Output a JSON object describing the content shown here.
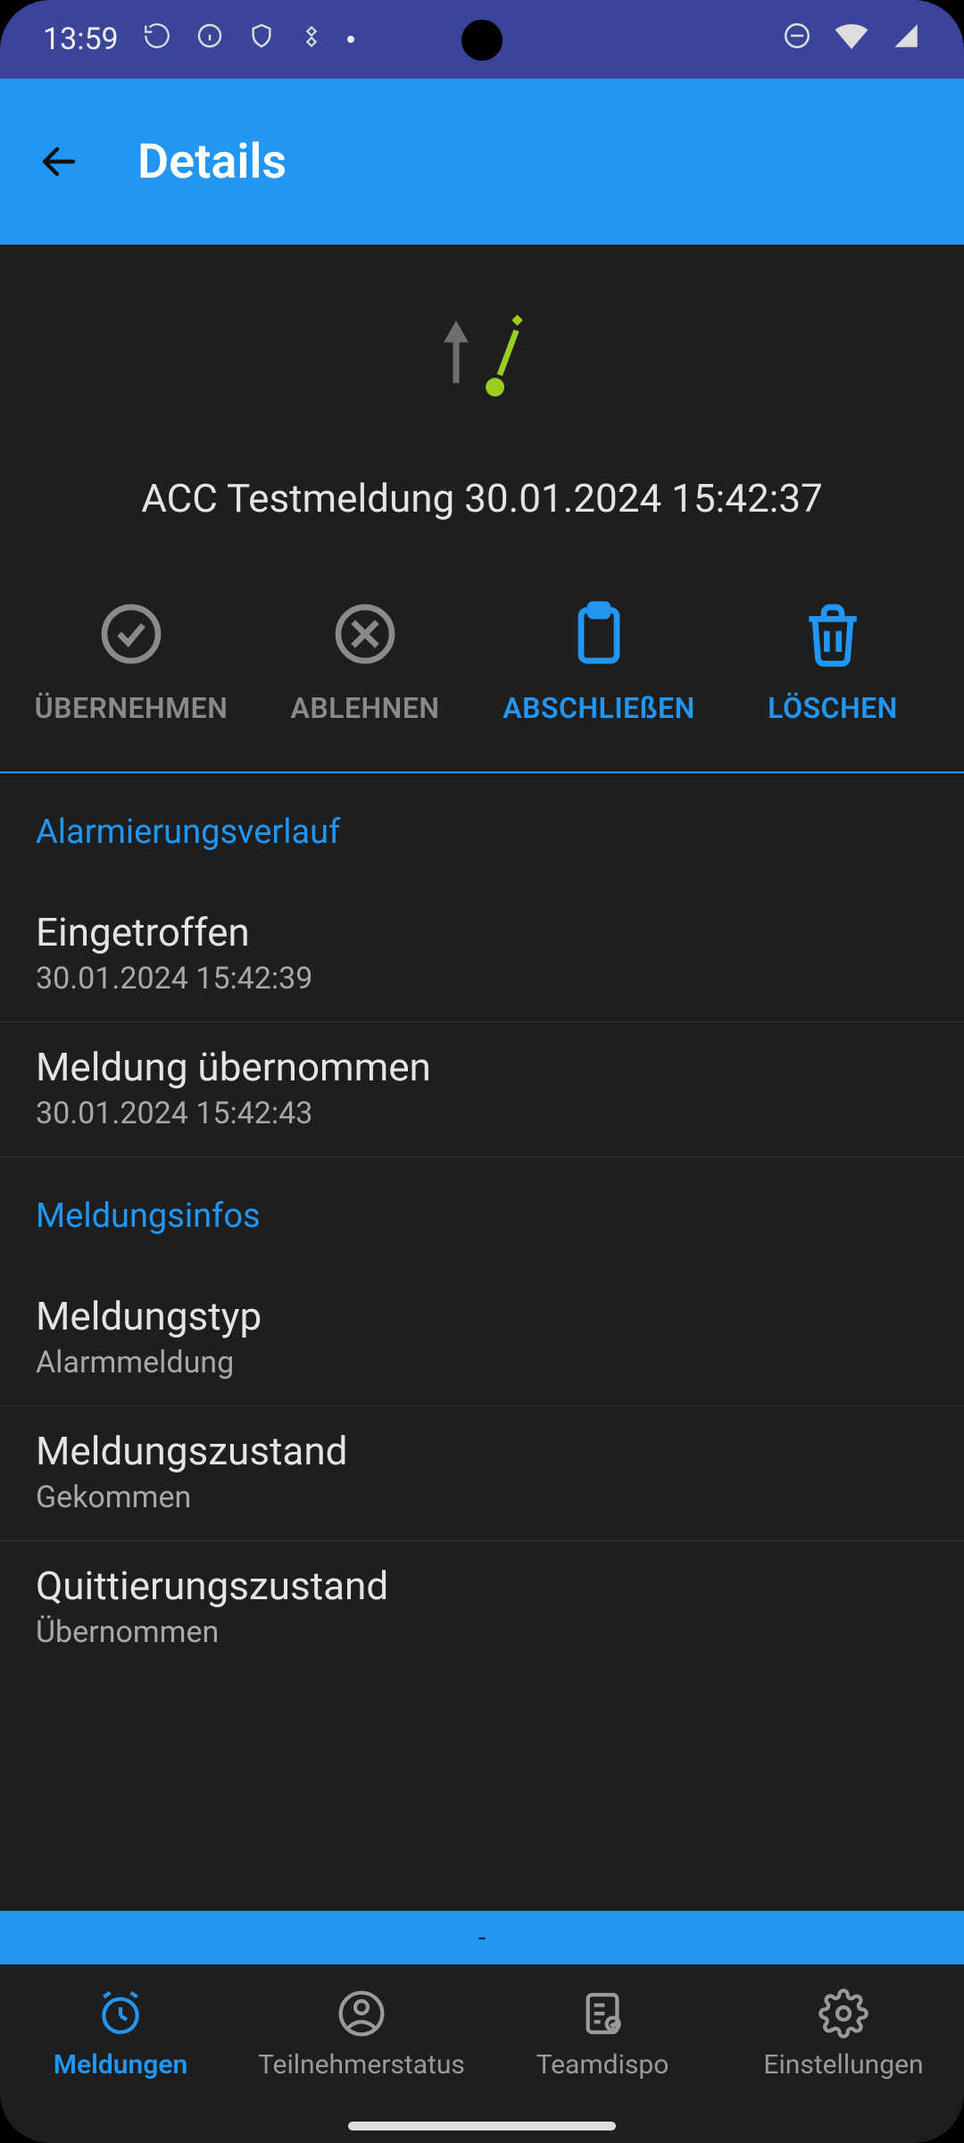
{
  "status_bar": {
    "time": "13:59"
  },
  "app_bar": {
    "title": "Details"
  },
  "hero": {
    "title": "ACC Testmeldung 30.01.2024 15:42:37"
  },
  "actions": {
    "accept": {
      "label": "ÜBERNEHMEN"
    },
    "reject": {
      "label": "ABLEHNEN"
    },
    "complete": {
      "label": "ABSCHLIEßEN"
    },
    "delete": {
      "label": "LÖSCHEN"
    }
  },
  "sections": {
    "history": {
      "header": "Alarmierungsverlauf",
      "items": [
        {
          "primary": "Eingetroffen",
          "secondary": "30.01.2024 15:42:39"
        },
        {
          "primary": "Meldung übernommen",
          "secondary": "30.01.2024 15:42:43"
        }
      ]
    },
    "info": {
      "header": "Meldungsinfos",
      "items": [
        {
          "primary": "Meldungstyp",
          "secondary": "Alarmmeldung"
        },
        {
          "primary": "Meldungszustand",
          "secondary": "Gekommen"
        },
        {
          "primary": "Quittierungszustand",
          "secondary": "Übernommen"
        }
      ]
    }
  },
  "bottom_strip": {
    "text": "-"
  },
  "nav": {
    "items": [
      {
        "label": "Meldungen"
      },
      {
        "label": "Teilnehmerstatus"
      },
      {
        "label": "Teamdispo"
      },
      {
        "label": "Einstellungen"
      }
    ]
  }
}
